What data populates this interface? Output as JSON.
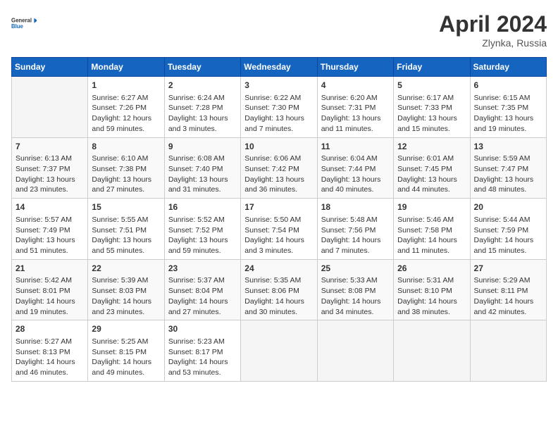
{
  "header": {
    "logo_line1": "General",
    "logo_line2": "Blue",
    "month": "April 2024",
    "location": "Zlynka, Russia"
  },
  "columns": [
    "Sunday",
    "Monday",
    "Tuesday",
    "Wednesday",
    "Thursday",
    "Friday",
    "Saturday"
  ],
  "weeks": [
    [
      {
        "day": "",
        "info": ""
      },
      {
        "day": "1",
        "info": "Sunrise: 6:27 AM\nSunset: 7:26 PM\nDaylight: 12 hours\nand 59 minutes."
      },
      {
        "day": "2",
        "info": "Sunrise: 6:24 AM\nSunset: 7:28 PM\nDaylight: 13 hours\nand 3 minutes."
      },
      {
        "day": "3",
        "info": "Sunrise: 6:22 AM\nSunset: 7:30 PM\nDaylight: 13 hours\nand 7 minutes."
      },
      {
        "day": "4",
        "info": "Sunrise: 6:20 AM\nSunset: 7:31 PM\nDaylight: 13 hours\nand 11 minutes."
      },
      {
        "day": "5",
        "info": "Sunrise: 6:17 AM\nSunset: 7:33 PM\nDaylight: 13 hours\nand 15 minutes."
      },
      {
        "day": "6",
        "info": "Sunrise: 6:15 AM\nSunset: 7:35 PM\nDaylight: 13 hours\nand 19 minutes."
      }
    ],
    [
      {
        "day": "7",
        "info": "Sunrise: 6:13 AM\nSunset: 7:37 PM\nDaylight: 13 hours\nand 23 minutes."
      },
      {
        "day": "8",
        "info": "Sunrise: 6:10 AM\nSunset: 7:38 PM\nDaylight: 13 hours\nand 27 minutes."
      },
      {
        "day": "9",
        "info": "Sunrise: 6:08 AM\nSunset: 7:40 PM\nDaylight: 13 hours\nand 31 minutes."
      },
      {
        "day": "10",
        "info": "Sunrise: 6:06 AM\nSunset: 7:42 PM\nDaylight: 13 hours\nand 36 minutes."
      },
      {
        "day": "11",
        "info": "Sunrise: 6:04 AM\nSunset: 7:44 PM\nDaylight: 13 hours\nand 40 minutes."
      },
      {
        "day": "12",
        "info": "Sunrise: 6:01 AM\nSunset: 7:45 PM\nDaylight: 13 hours\nand 44 minutes."
      },
      {
        "day": "13",
        "info": "Sunrise: 5:59 AM\nSunset: 7:47 PM\nDaylight: 13 hours\nand 48 minutes."
      }
    ],
    [
      {
        "day": "14",
        "info": "Sunrise: 5:57 AM\nSunset: 7:49 PM\nDaylight: 13 hours\nand 51 minutes."
      },
      {
        "day": "15",
        "info": "Sunrise: 5:55 AM\nSunset: 7:51 PM\nDaylight: 13 hours\nand 55 minutes."
      },
      {
        "day": "16",
        "info": "Sunrise: 5:52 AM\nSunset: 7:52 PM\nDaylight: 13 hours\nand 59 minutes."
      },
      {
        "day": "17",
        "info": "Sunrise: 5:50 AM\nSunset: 7:54 PM\nDaylight: 14 hours\nand 3 minutes."
      },
      {
        "day": "18",
        "info": "Sunrise: 5:48 AM\nSunset: 7:56 PM\nDaylight: 14 hours\nand 7 minutes."
      },
      {
        "day": "19",
        "info": "Sunrise: 5:46 AM\nSunset: 7:58 PM\nDaylight: 14 hours\nand 11 minutes."
      },
      {
        "day": "20",
        "info": "Sunrise: 5:44 AM\nSunset: 7:59 PM\nDaylight: 14 hours\nand 15 minutes."
      }
    ],
    [
      {
        "day": "21",
        "info": "Sunrise: 5:42 AM\nSunset: 8:01 PM\nDaylight: 14 hours\nand 19 minutes."
      },
      {
        "day": "22",
        "info": "Sunrise: 5:39 AM\nSunset: 8:03 PM\nDaylight: 14 hours\nand 23 minutes."
      },
      {
        "day": "23",
        "info": "Sunrise: 5:37 AM\nSunset: 8:04 PM\nDaylight: 14 hours\nand 27 minutes."
      },
      {
        "day": "24",
        "info": "Sunrise: 5:35 AM\nSunset: 8:06 PM\nDaylight: 14 hours\nand 30 minutes."
      },
      {
        "day": "25",
        "info": "Sunrise: 5:33 AM\nSunset: 8:08 PM\nDaylight: 14 hours\nand 34 minutes."
      },
      {
        "day": "26",
        "info": "Sunrise: 5:31 AM\nSunset: 8:10 PM\nDaylight: 14 hours\nand 38 minutes."
      },
      {
        "day": "27",
        "info": "Sunrise: 5:29 AM\nSunset: 8:11 PM\nDaylight: 14 hours\nand 42 minutes."
      }
    ],
    [
      {
        "day": "28",
        "info": "Sunrise: 5:27 AM\nSunset: 8:13 PM\nDaylight: 14 hours\nand 46 minutes."
      },
      {
        "day": "29",
        "info": "Sunrise: 5:25 AM\nSunset: 8:15 PM\nDaylight: 14 hours\nand 49 minutes."
      },
      {
        "day": "30",
        "info": "Sunrise: 5:23 AM\nSunset: 8:17 PM\nDaylight: 14 hours\nand 53 minutes."
      },
      {
        "day": "",
        "info": ""
      },
      {
        "day": "",
        "info": ""
      },
      {
        "day": "",
        "info": ""
      },
      {
        "day": "",
        "info": ""
      }
    ]
  ]
}
